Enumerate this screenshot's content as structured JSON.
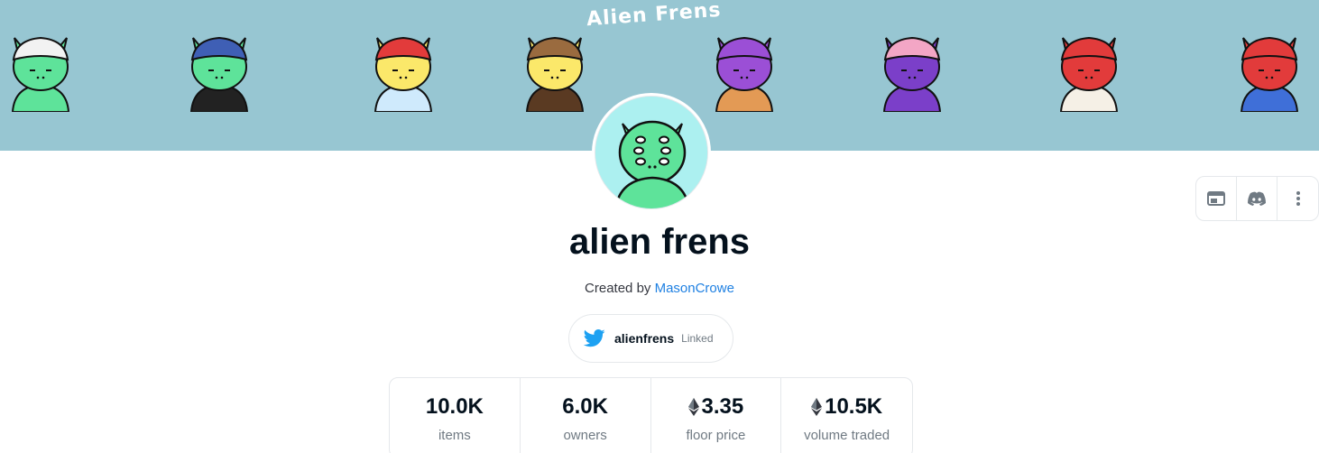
{
  "banner": {
    "title": "Alien Frens",
    "aliens": [
      {
        "icon": "alien-helmet",
        "skin": "#5ee39a",
        "shirt": "#5ee39a",
        "hat": "#f2f2f2"
      },
      {
        "icon": "alien-beanie",
        "skin": "#5ee39a",
        "shirt": "#222222",
        "hat": "#3f5fb5"
      },
      {
        "icon": "alien-bow",
        "skin": "#fbe86a",
        "shirt": "#cfeafc",
        "hat": "#e23b3b"
      },
      {
        "icon": "alien-cowboy",
        "skin": "#fbe86a",
        "shirt": "#5a3a22",
        "hat": "#9a6b3f"
      },
      {
        "icon": "alien-purple-chain",
        "skin": "#9b4fd6",
        "shirt": "#e39a55",
        "hat": "#9b4fd6"
      },
      {
        "icon": "alien-purple-beard",
        "skin": "#7b3fc9",
        "shirt": "#7b3fc9",
        "hat": "#f3a6c5"
      },
      {
        "icon": "alien-red-x-eyes",
        "skin": "#e23b3b",
        "shirt": "#f5f0e6",
        "hat": "#e23b3b"
      },
      {
        "icon": "alien-red-cape",
        "skin": "#e23b3b",
        "shirt": "#3f6fd8",
        "hat": "#e23b3b"
      }
    ]
  },
  "collection": {
    "name": "alien frens",
    "created_prefix": "Created by",
    "creator": "MasonCrowe",
    "avatar_icon": "green-alien-avatar"
  },
  "actions": [
    {
      "icon": "website-icon"
    },
    {
      "icon": "discord-icon"
    },
    {
      "icon": "more-vertical-icon"
    }
  ],
  "twitter": {
    "handle": "alienfrens",
    "status": "Linked",
    "icon": "twitter-bird-icon"
  },
  "stats": [
    {
      "value": "10.0K",
      "label": "items",
      "eth": false
    },
    {
      "value": "6.0K",
      "label": "owners",
      "eth": false
    },
    {
      "value": "3.35",
      "label": "floor price",
      "eth": true
    },
    {
      "value": "10.5K",
      "label": "volume traded",
      "eth": true
    }
  ],
  "colors": {
    "banner_bg": "#97c6d2",
    "link": "#2081e2",
    "twitter_blue": "#1da1f2",
    "avatar_bg": "#acf0f0",
    "alien_green": "#5ee39a"
  }
}
